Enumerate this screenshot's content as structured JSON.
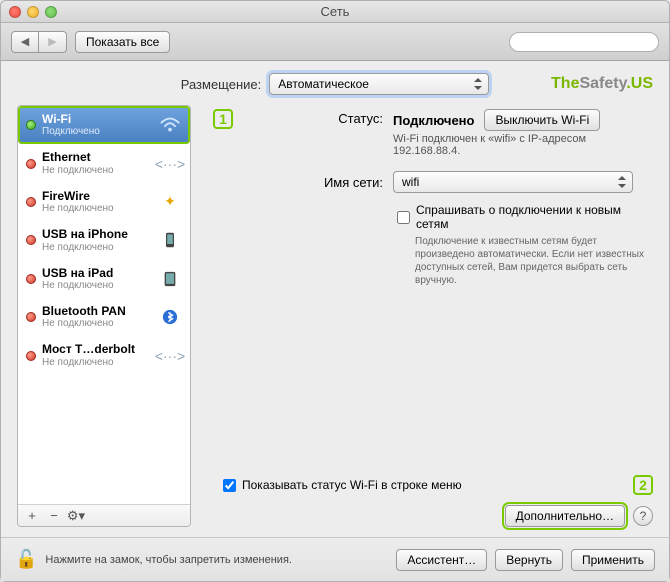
{
  "window": {
    "title": "Сеть"
  },
  "toolbar": {
    "show_all": "Показать все",
    "search_placeholder": ""
  },
  "location": {
    "label": "Размещение:",
    "value": "Автоматическое"
  },
  "brand": {
    "the": "The",
    "safety": "Safety",
    "us": ".US"
  },
  "sidebar": {
    "items": [
      {
        "name": "Wi-Fi",
        "status": "Подключено",
        "dot": "green"
      },
      {
        "name": "Ethernet",
        "status": "Не подключено",
        "dot": "red"
      },
      {
        "name": "FireWire",
        "status": "Не подключено",
        "dot": "red"
      },
      {
        "name": "USB на iPhone",
        "status": "Не подключено",
        "dot": "red"
      },
      {
        "name": "USB на iPad",
        "status": "Не подключено",
        "dot": "red"
      },
      {
        "name": "Bluetooth PAN",
        "status": "Не подключено",
        "dot": "red"
      },
      {
        "name": "Мост T…derbolt",
        "status": "Не подключено",
        "dot": "red"
      }
    ]
  },
  "steps": {
    "one": "1",
    "two": "2"
  },
  "detail": {
    "status_label": "Статус:",
    "status_value": "Подключено",
    "status_desc": "Wi-Fi подключен к «wifi» с IP-адресом 192.168.88.4.",
    "toggle_button": "Выключить Wi-Fi",
    "network_label": "Имя сети:",
    "network_value": "wifi",
    "ask_join_label": "Спрашивать о подключении к новым сетям",
    "ask_join_hint": "Подключение к известным сетям будет произведено автоматически. Если нет известных доступных сетей, Вам придется выбрать сеть вручную.",
    "show_status_label": "Показывать статус Wi-Fi в строке меню",
    "advanced_button": "Дополнительно…",
    "help": "?"
  },
  "footer": {
    "lock_text": "Нажмите на замок, чтобы запретить изменения.",
    "assistant": "Ассистент…",
    "revert": "Вернуть",
    "apply": "Применить"
  }
}
